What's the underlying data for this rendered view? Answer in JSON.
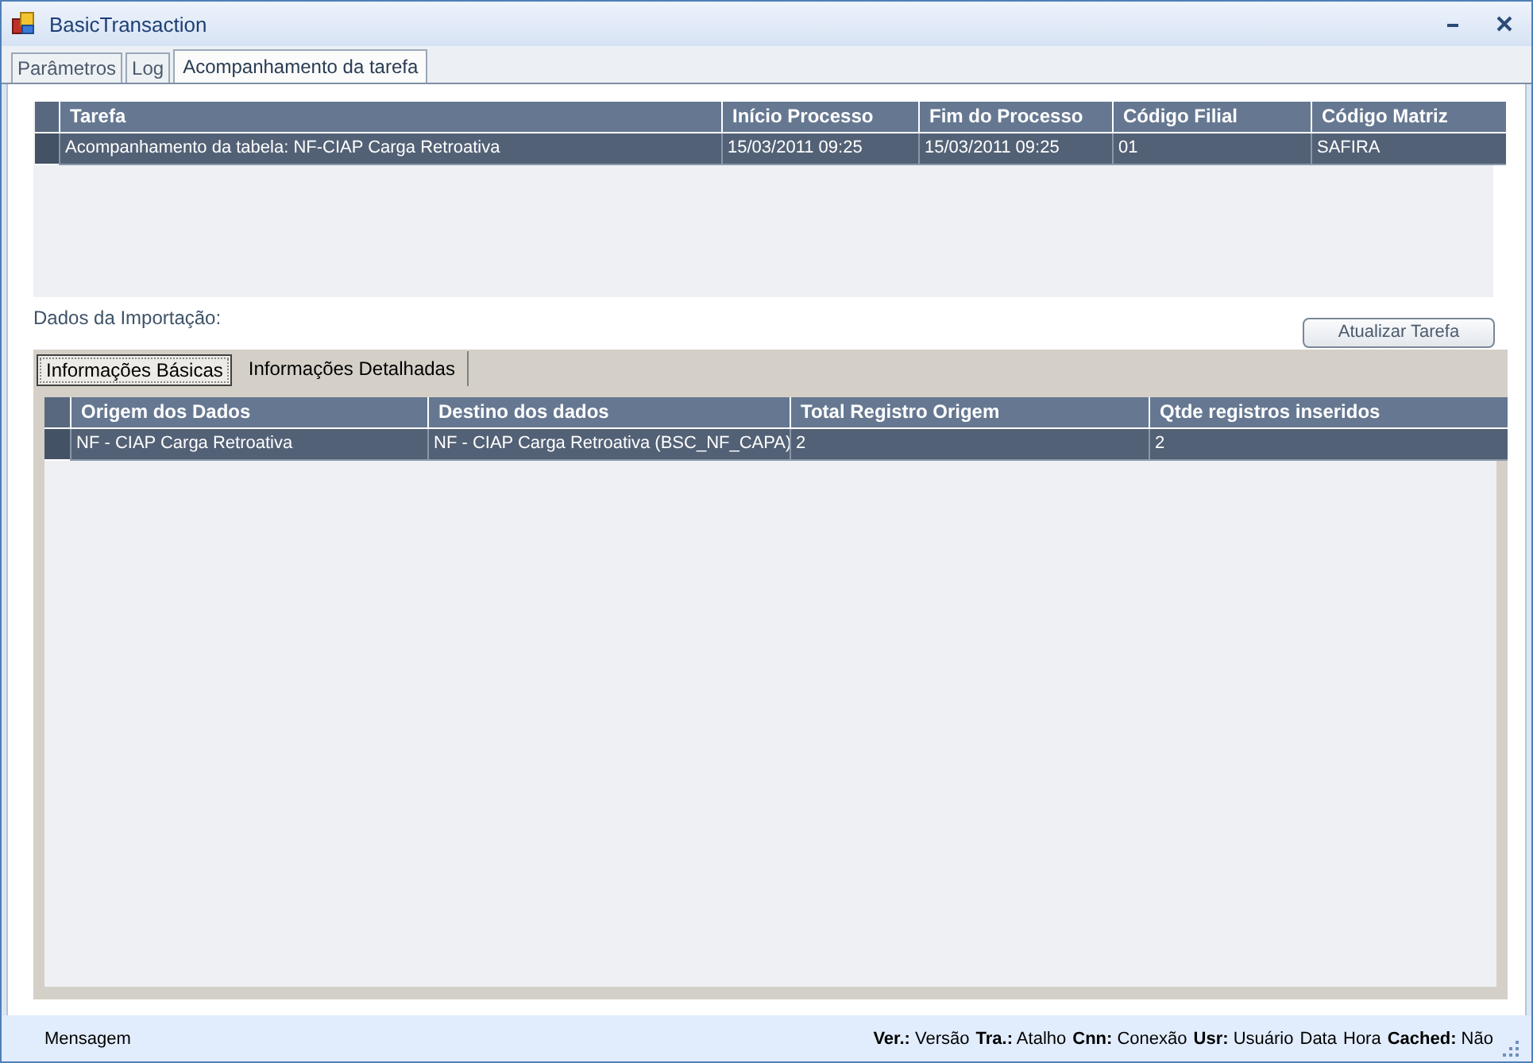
{
  "window": {
    "title": "BasicTransaction"
  },
  "tabs": [
    {
      "label": "Parâmetros",
      "selected": false
    },
    {
      "label": "Log",
      "selected": false
    },
    {
      "label": "Acompanhamento da tarefa",
      "selected": true
    }
  ],
  "task_table": {
    "columns": [
      "Tarefa",
      "Início Processo",
      "Fim do Processo",
      "Código Filial",
      "Código Matriz"
    ],
    "rows": [
      {
        "selected": true,
        "cells": [
          "Acompanhamento da tabela: NF-CIAP Carga Retroativa",
          "15/03/2011 09:25",
          "15/03/2011 09:25",
          "01",
          "SAFIRA"
        ]
      }
    ]
  },
  "import_label": "Dados da Importação:",
  "refresh_button": "Atualizar Tarefa",
  "import_tabs": [
    {
      "label": "Informações Básicas",
      "selected": true
    },
    {
      "label": "Informações Detalhadas",
      "selected": false
    }
  ],
  "import_table": {
    "columns": [
      "Origem dos Dados",
      "Destino dos dados",
      "Total Registro Origem",
      "Qtde registros inseridos"
    ],
    "rows": [
      {
        "selected": true,
        "cells": [
          "NF - CIAP Carga Retroativa",
          "NF - CIAP Carga Retroativa (BSC_NF_CAPA)",
          "2",
          "2"
        ]
      }
    ]
  },
  "status_bar": {
    "message": "Mensagem",
    "items": [
      "**Ver.:** Versão",
      "**Tra.:** Atalho",
      "**Cnn:** Conexão",
      "**Usr:** Usuário",
      "Data",
      "Hora",
      "**Cached:** Não"
    ]
  }
}
